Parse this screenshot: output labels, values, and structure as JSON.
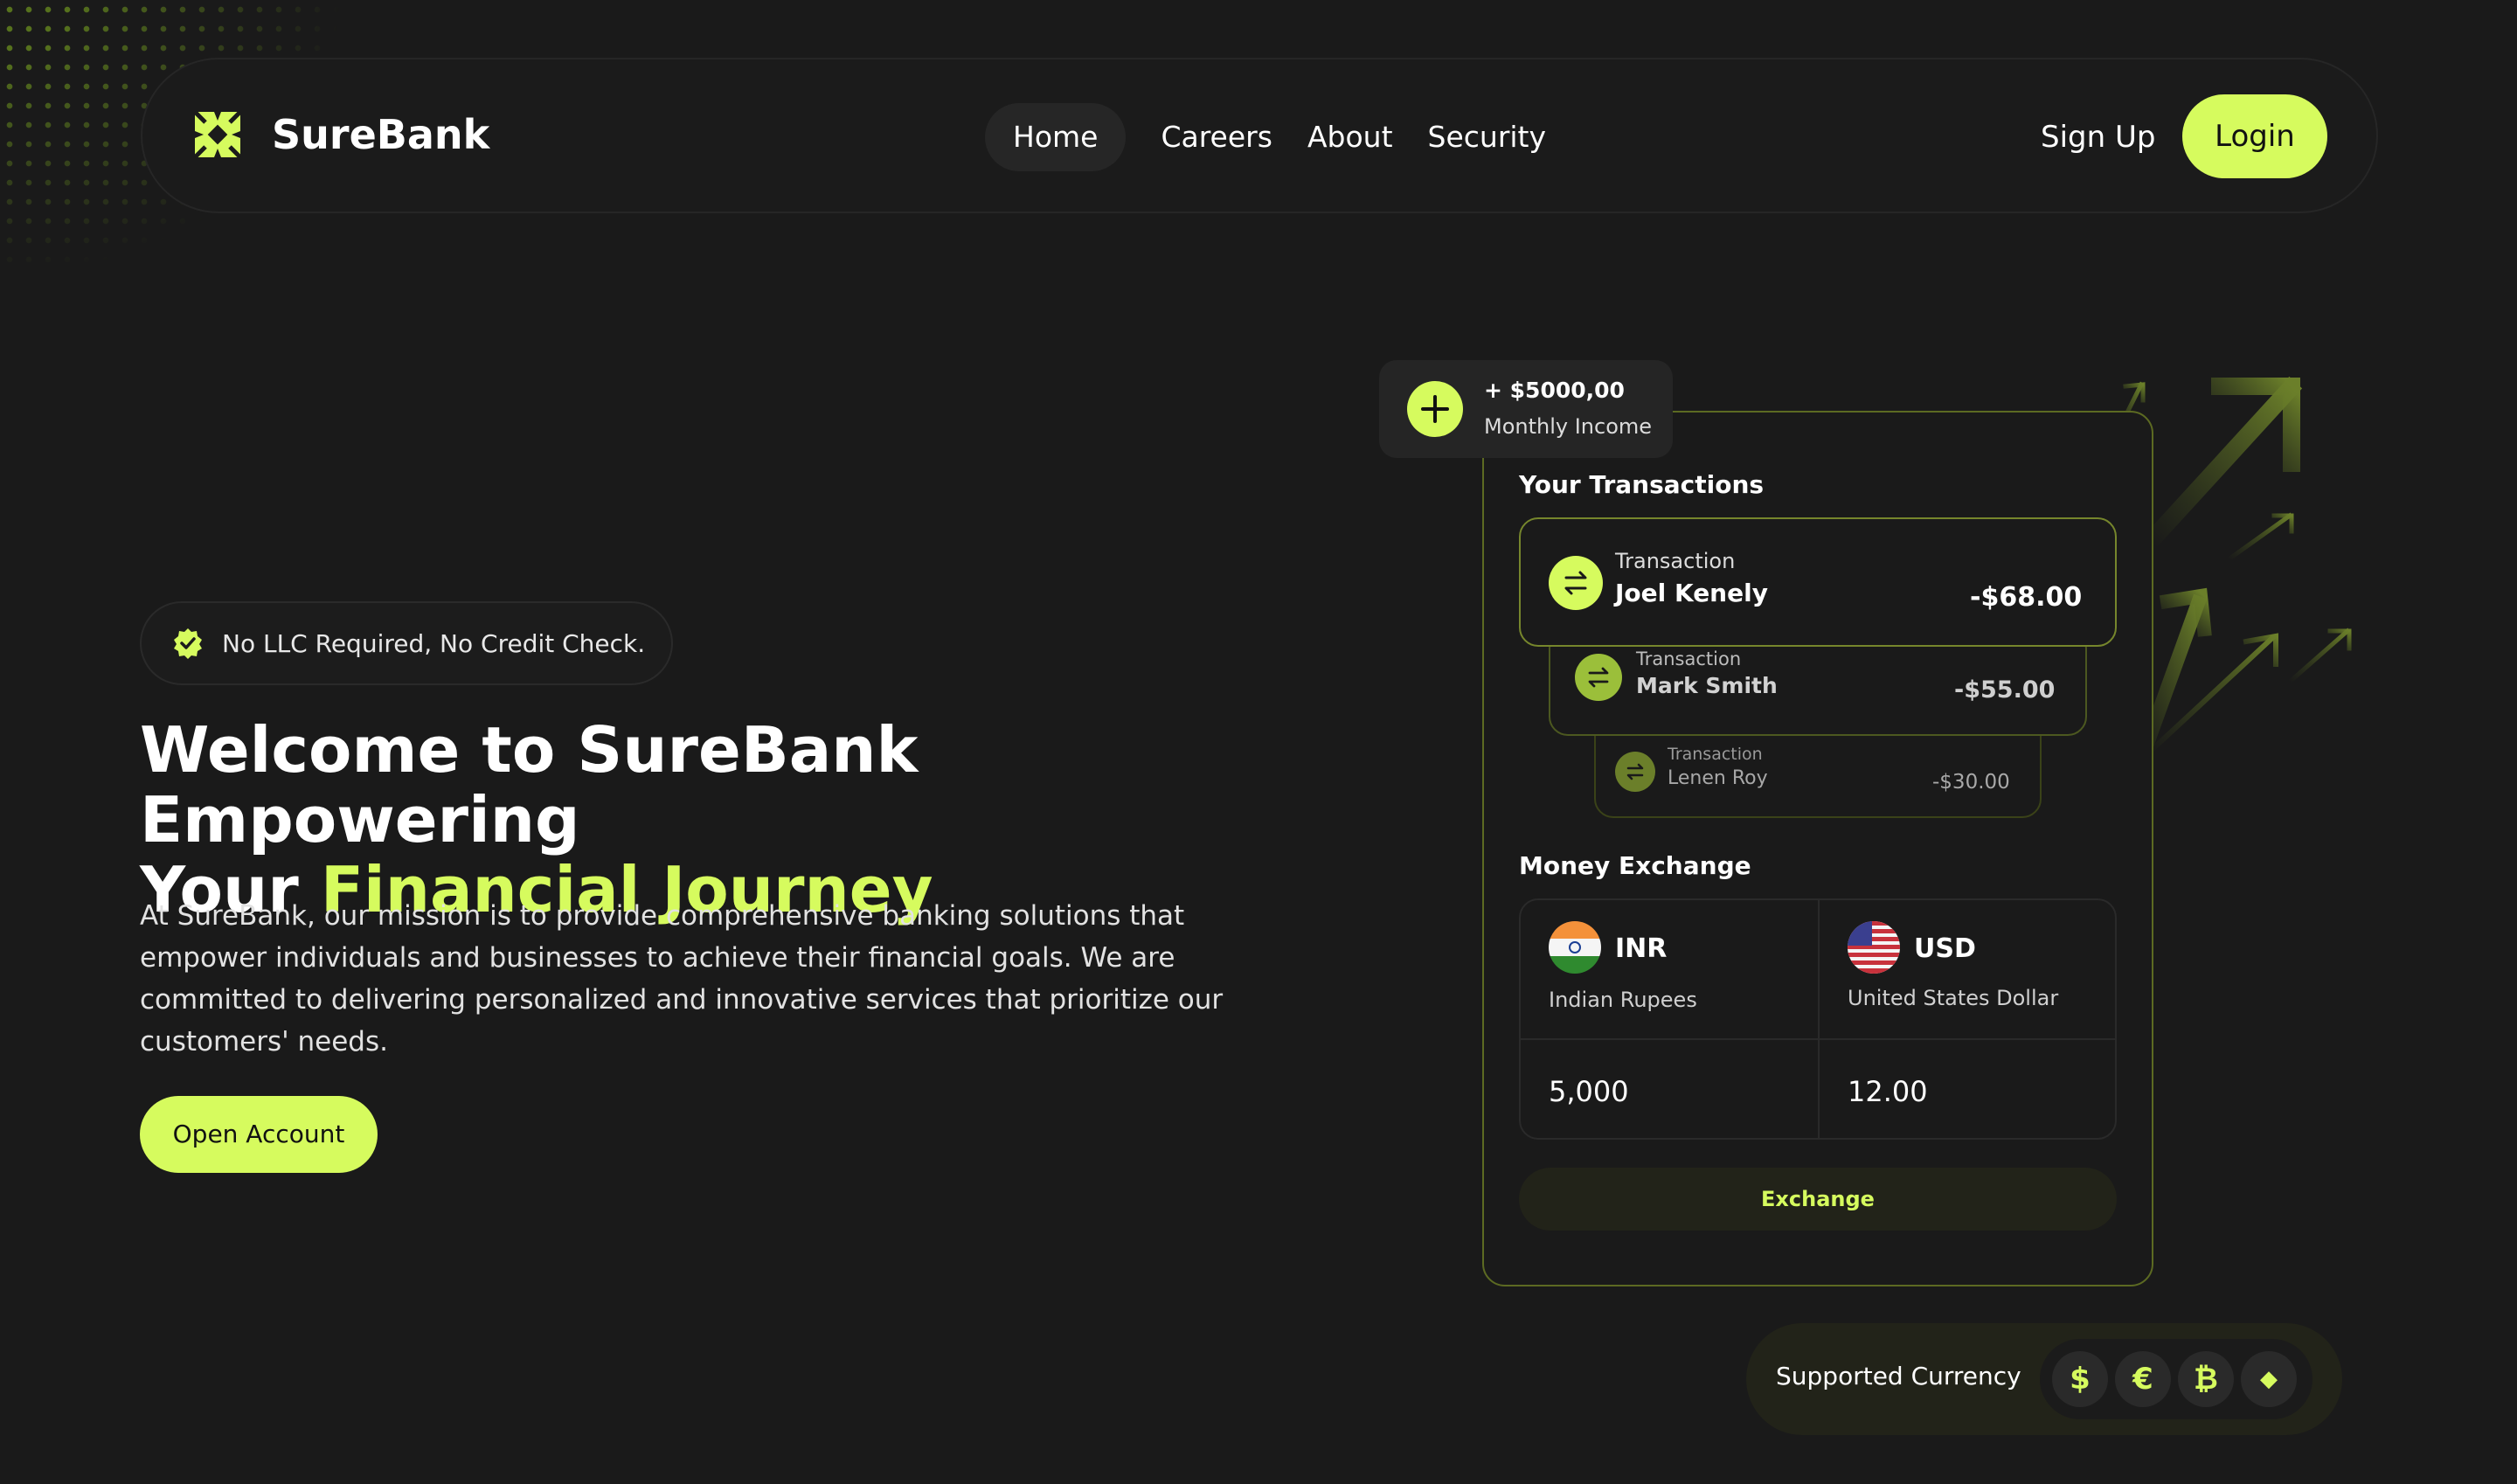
{
  "brand": {
    "name": "SureBank",
    "logo_icon": "surebank-logo-icon"
  },
  "nav": {
    "items": [
      {
        "label": "Home",
        "active": true
      },
      {
        "label": "Careers",
        "active": false
      },
      {
        "label": "About",
        "active": false
      },
      {
        "label": "Security",
        "active": false
      }
    ],
    "signup_label": "Sign Up",
    "login_label": "Login"
  },
  "hero": {
    "badge_text": "No LLC Required, No Credit Check.",
    "title_line1": "Welcome to SureBank Empowering",
    "title_line2_prefix": "Your ",
    "title_accent": "Financial Journey",
    "description": "At SureBank, our mission is to provide comprehensive banking solutions that empower individuals and businesses to achieve their financial goals. We are committed to delivering personalized and innovative services that prioritize our customers' needs.",
    "cta_label": "Open Account"
  },
  "income": {
    "amount": "+ $5000,00",
    "label": "Monthly Income"
  },
  "transactions": {
    "title": "Your Transactions",
    "items": [
      {
        "label": "Transaction",
        "name": "Joel Kenely",
        "amount": "-$68.00"
      },
      {
        "label": "Transaction",
        "name": "Mark Smith",
        "amount": "-$55.00"
      },
      {
        "label": "Transaction",
        "name": "Lenen Roy",
        "amount": "-$30.00"
      }
    ]
  },
  "exchange": {
    "title": "Money Exchange",
    "from": {
      "code": "INR",
      "name": "Indian Rupees",
      "value": "5,000"
    },
    "to": {
      "code": "USD",
      "name": "United States Dollar",
      "value": "12.00"
    },
    "button_label": "Exchange"
  },
  "supported": {
    "label": "Supported Currency",
    "icons": [
      {
        "name": "dollar-icon",
        "glyph": "$"
      },
      {
        "name": "euro-icon",
        "glyph": "€"
      },
      {
        "name": "bitcoin-icon",
        "glyph": "₿"
      },
      {
        "name": "ethereum-icon",
        "glyph": "◆"
      }
    ]
  },
  "colors": {
    "accent": "#d6fb5e",
    "background": "#1a1a1a",
    "border_accent": "#5c6a22"
  }
}
